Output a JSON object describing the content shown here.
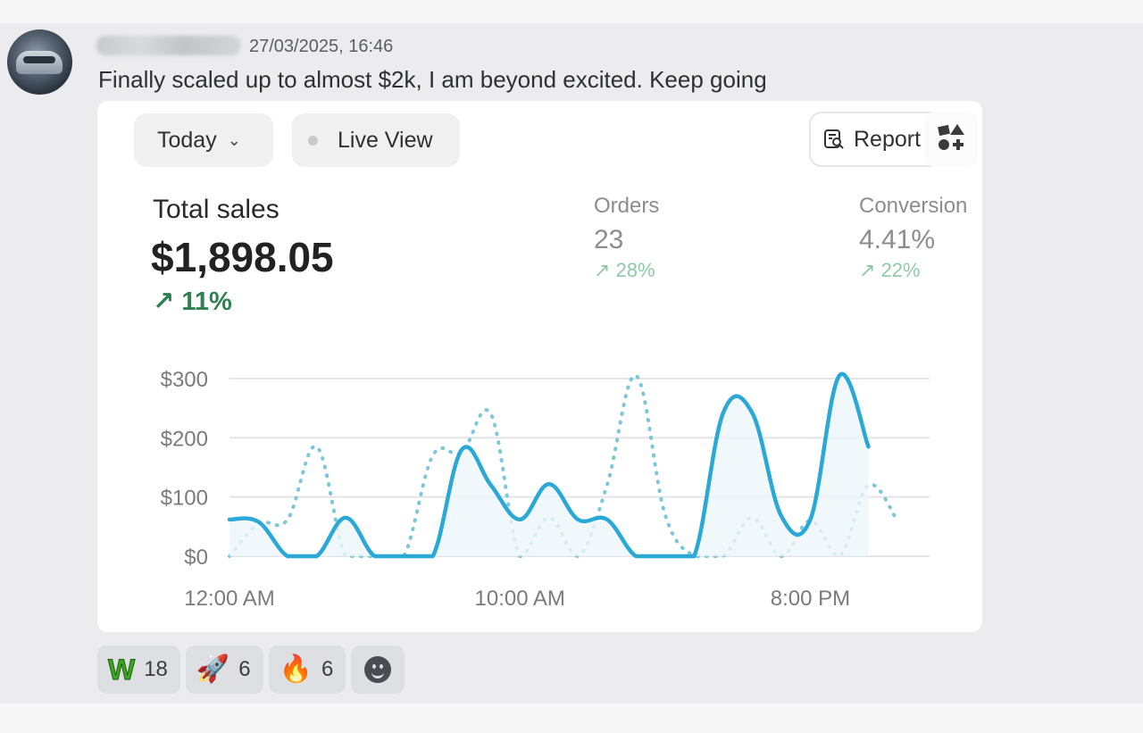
{
  "message": {
    "timestamp": "27/03/2025, 16:46",
    "text": "Finally scaled up to almost $2k, I am beyond excited. Keep going"
  },
  "dashboard": {
    "date_filter": "Today",
    "live_view_label": "Live View",
    "report_label": "Report",
    "total_sales": {
      "label": "Total sales",
      "value": "$1,898.05",
      "delta": "11%"
    },
    "orders": {
      "label": "Orders",
      "value": "23",
      "delta": "28%"
    },
    "conversion": {
      "label": "Conversion",
      "value": "4.41%",
      "delta": "22%"
    },
    "colors": {
      "today_line": "#2aa8d6",
      "comparison_line": "#7cc7d9",
      "positive": "#2f8052"
    }
  },
  "chart_data": {
    "type": "line",
    "xlabel": "",
    "ylabel": "",
    "x_tick_labels": [
      "12:00 AM",
      "10:00 AM",
      "8:00 PM"
    ],
    "y_tick_labels": [
      "$0",
      "$100",
      "$200",
      "$300"
    ],
    "ylim": [
      0,
      300
    ],
    "grid": true,
    "x_hours": [
      0,
      1,
      2,
      3,
      4,
      5,
      6,
      7,
      8,
      9,
      10,
      11,
      12,
      13,
      14,
      15,
      16,
      17,
      18,
      19,
      20,
      21,
      22,
      23
    ],
    "series": [
      {
        "style": "solid",
        "values": [
          62,
          58,
          0,
          0,
          65,
          0,
          0,
          0,
          180,
          120,
          62,
          122,
          62,
          62,
          0,
          0,
          0,
          242,
          242,
          68,
          62,
          305,
          185
        ]
      },
      {
        "style": "dotted",
        "values": [
          0,
          55,
          62,
          185,
          0,
          0,
          0,
          170,
          175,
          240,
          0,
          65,
          0,
          120,
          305,
          70,
          0,
          0,
          65,
          0,
          60,
          0,
          120,
          60
        ]
      }
    ]
  },
  "reactions": [
    {
      "emoji": "W",
      "count": "18"
    },
    {
      "emoji": "🚀",
      "count": "6"
    },
    {
      "emoji": "🔥",
      "count": "6"
    }
  ]
}
